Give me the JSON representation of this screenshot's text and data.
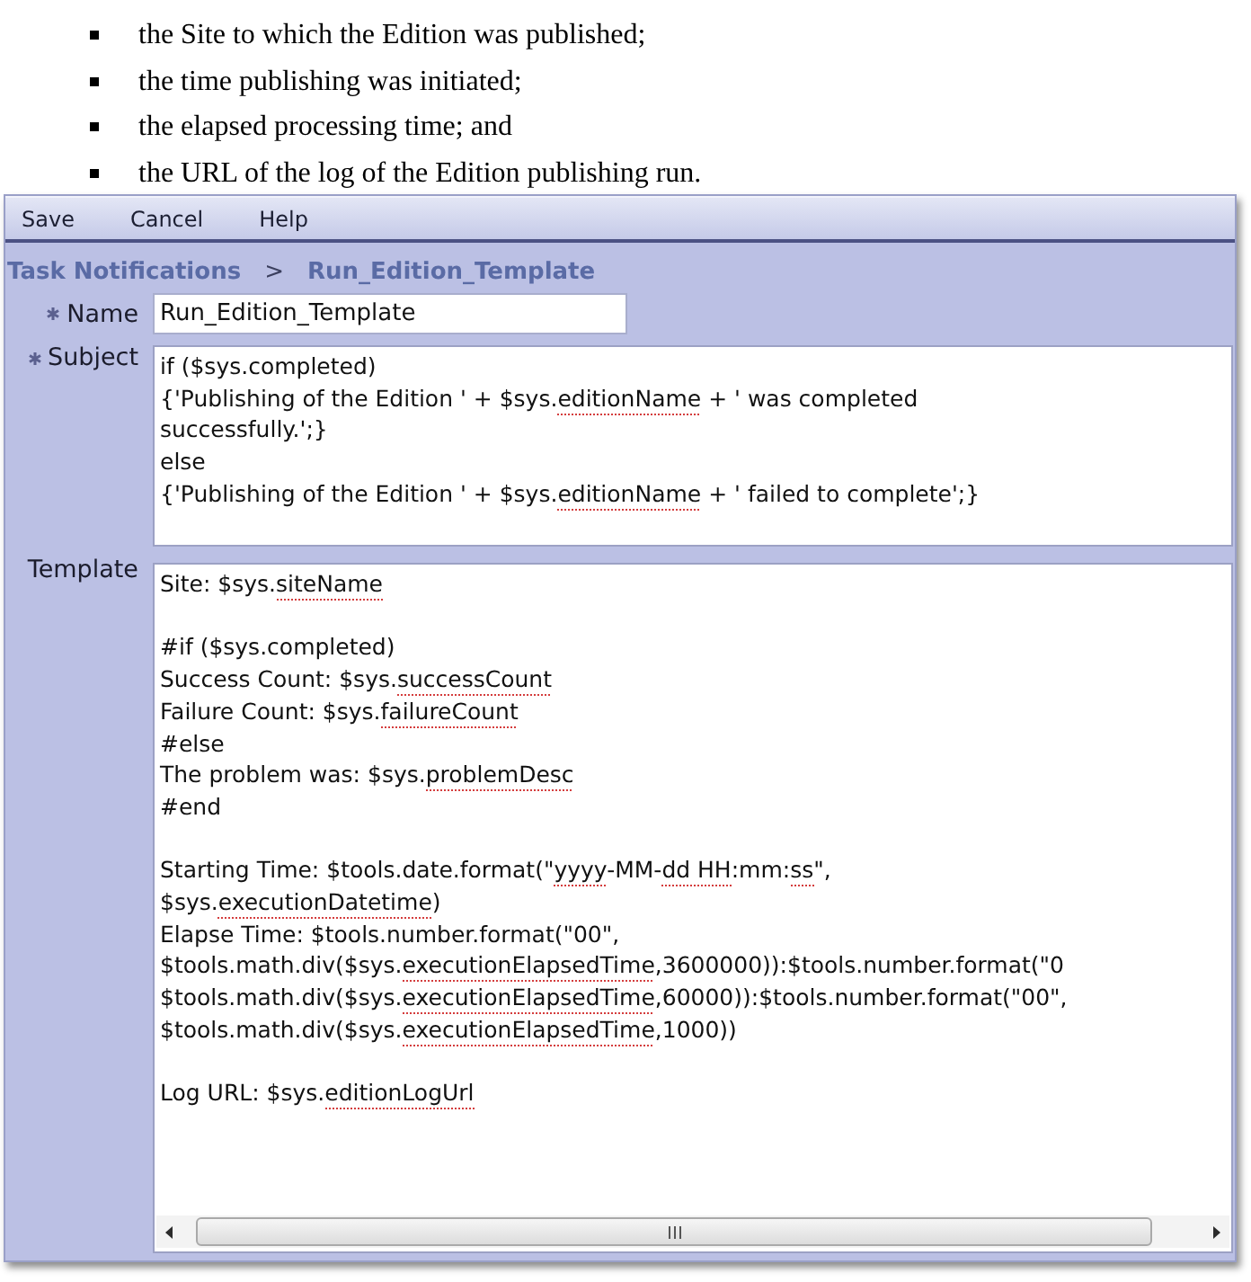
{
  "bullets": [
    "the Site to which the Edition was published;",
    "the time publishing was initiated;",
    "the elapsed processing time; and",
    "the URL of the log of the Edition publishing run."
  ],
  "toolbar": {
    "buttons": [
      "Save",
      "Cancel",
      "Help"
    ]
  },
  "breadcrumb": [
    {
      "kind": "link",
      "text": "Task Notifications"
    },
    {
      "kind": "separator",
      "text": ">"
    },
    {
      "kind": "current",
      "text": "Run_Edition_Template"
    }
  ],
  "fields": [
    {
      "kind": "input",
      "label": "Name",
      "required": true,
      "value": "Run_Edition_Template"
    },
    {
      "kind": "textarea",
      "label": "Subject",
      "required": true,
      "horizontal_scrollbar": false,
      "segments": [
        {
          "text": "if ($sys.completed)\n{'Publishing of the Edition ' + $sys.",
          "misspelled": false
        },
        {
          "text": "editionName",
          "misspelled": true
        },
        {
          "text": " + ' was completed\nsuccessfully.';}\nelse\n{'Publishing of the Edition ' + $sys.",
          "misspelled": false
        },
        {
          "text": "editionName",
          "misspelled": true
        },
        {
          "text": " + ' failed to complete';}",
          "misspelled": false
        }
      ]
    },
    {
      "kind": "textarea",
      "label": "Template",
      "required": false,
      "horizontal_scrollbar": true,
      "segments": [
        {
          "text": "Site: $sys.",
          "misspelled": false
        },
        {
          "text": "siteName",
          "misspelled": true
        },
        {
          "text": "\n\n#if ($sys.completed)\nSuccess Count: $sys.",
          "misspelled": false
        },
        {
          "text": "successCount",
          "misspelled": true
        },
        {
          "text": "\nFailure Count: $sys.",
          "misspelled": false
        },
        {
          "text": "failureCount",
          "misspelled": true
        },
        {
          "text": "\n#else\nThe problem was: $sys.",
          "misspelled": false
        },
        {
          "text": "problemDesc",
          "misspelled": true
        },
        {
          "text": "\n#end\n\nStarting Time: $tools.date.format(\"",
          "misspelled": false
        },
        {
          "text": "yyyy",
          "misspelled": true
        },
        {
          "text": "-MM-",
          "misspelled": false
        },
        {
          "text": "dd",
          "misspelled": true
        },
        {
          "text": " HH",
          "misspelled": true
        },
        {
          "text": ":mm:",
          "misspelled": false
        },
        {
          "text": "ss",
          "misspelled": true
        },
        {
          "text": "\",\n$sys.",
          "misspelled": false
        },
        {
          "text": "executionDatetime",
          "misspelled": true
        },
        {
          "text": ")\nElapse Time: $tools.number.format(\"00\",\n$tools.math.div($sys.",
          "misspelled": false
        },
        {
          "text": "executionElapsedTime",
          "misspelled": true
        },
        {
          "text": ",3600000)):$tools.number.format(\"0\n$tools.math.div($sys.",
          "misspelled": false
        },
        {
          "text": "executionElapsedTime",
          "misspelled": true
        },
        {
          "text": ",60000)):$tools.number.format(\"00\",\n$tools.math.div($sys.",
          "misspelled": false
        },
        {
          "text": "executionElapsedTime",
          "misspelled": true
        },
        {
          "text": ",1000))\n\nLog URL: $sys.",
          "misspelled": false
        },
        {
          "text": "editionLogUrl",
          "misspelled": true
        }
      ]
    }
  ]
}
